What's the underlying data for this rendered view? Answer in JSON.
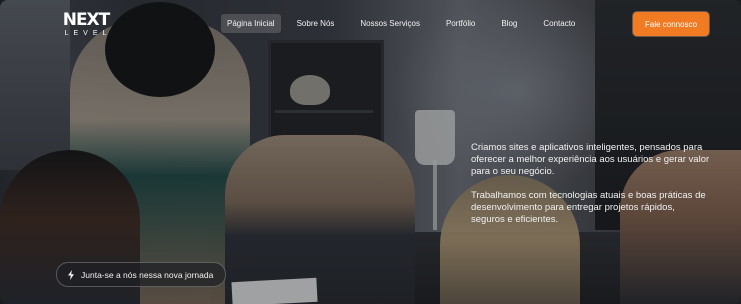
{
  "brand": {
    "logo_main": "NEXT",
    "logo_sub": "LEVEL"
  },
  "nav": {
    "items": [
      {
        "label": "Página Inicial",
        "active": true
      },
      {
        "label": "Sobre Nós"
      },
      {
        "label": "Nossos Serviços"
      },
      {
        "label": "Portfólio"
      },
      {
        "label": "Blog"
      },
      {
        "label": "Contacto"
      }
    ]
  },
  "cta": {
    "label": "Fale connosco"
  },
  "hero": {
    "paragraph_1": "Criamos sites e aplicativos inteligentes, pensados para oferecer a melhor experiência aos usuários e gerar valor para o seu negócio.",
    "paragraph_2": "Trabalhamos com tecnologias atuais e boas práticas de desenvolvimento para entregar projetos rápidos, seguros e eficientes.",
    "pill_label": "Junta-se a nós nessa nova jornada"
  },
  "colors": {
    "accent": "#f07b22"
  },
  "icons": {
    "pill": "lightning-bolt-icon"
  }
}
